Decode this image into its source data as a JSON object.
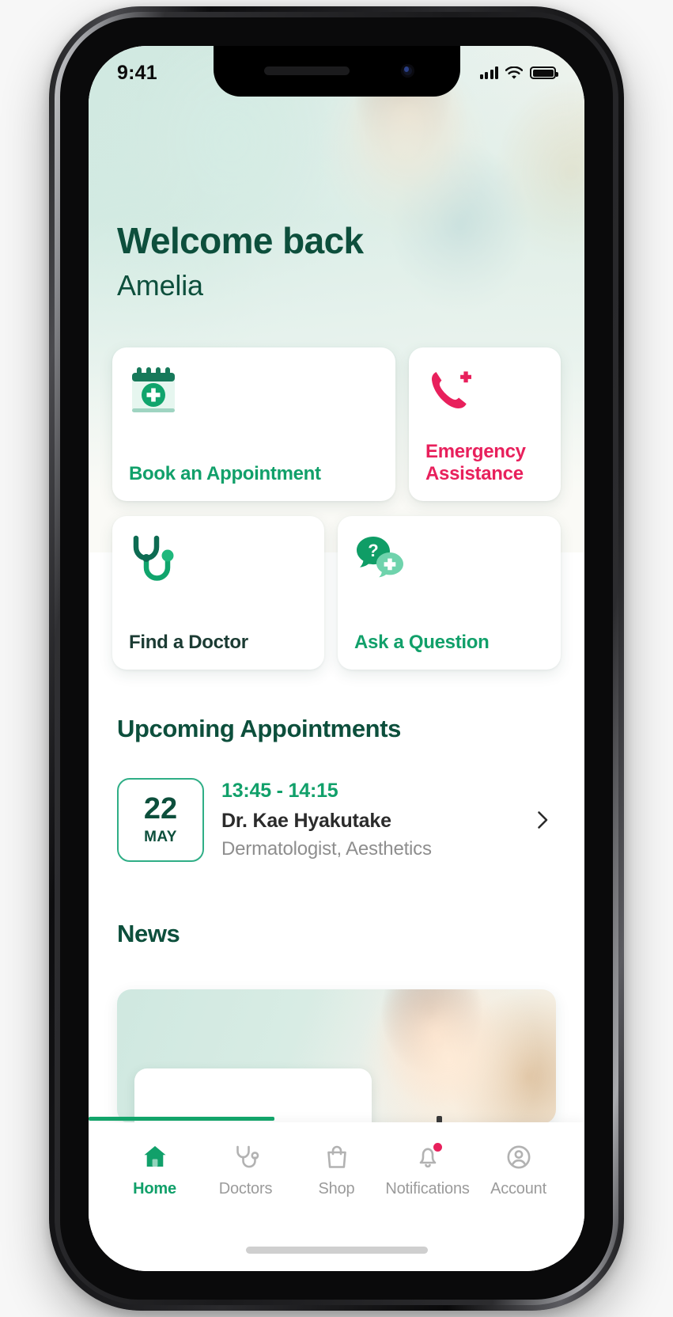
{
  "status_bar": {
    "time": "9:41",
    "signal_icon": "cellular-signal-icon",
    "wifi_icon": "wifi-icon",
    "battery_icon": "battery-full-icon"
  },
  "header": {
    "greeting": "Welcome back",
    "user_name": "Amelia"
  },
  "quick_actions": [
    {
      "id": "book-appointment",
      "label": "Book an Appointment",
      "icon": "calendar-plus-icon",
      "color": "#11a06a"
    },
    {
      "id": "emergency-assistance",
      "label": "Emergency Assistance",
      "icon": "phone-plus-icon",
      "color": "#e8205c"
    },
    {
      "id": "find-doctor",
      "label": "Find a Doctor",
      "icon": "stethoscope-icon",
      "color": "#1b3b33"
    },
    {
      "id": "ask-question",
      "label": "Ask a Question",
      "icon": "chat-question-icon",
      "color": "#11a06a"
    }
  ],
  "appointments": {
    "section_title": "Upcoming Appointments",
    "items": [
      {
        "day": "22",
        "month": "MAY",
        "time": "13:45 - 14:15",
        "doctor": "Dr. Kae Hyakutake",
        "specialty": "Dermatologist, Aesthetics",
        "chevron_icon": "chevron-right-icon"
      }
    ]
  },
  "news": {
    "section_title": "News"
  },
  "tab_bar": {
    "items": [
      {
        "id": "home",
        "label": "Home",
        "icon": "home-icon",
        "active": true,
        "badge": false
      },
      {
        "id": "doctors",
        "label": "Doctors",
        "icon": "stethoscope-icon",
        "active": false,
        "badge": false
      },
      {
        "id": "shop",
        "label": "Shop",
        "icon": "shopping-bag-icon",
        "active": false,
        "badge": false
      },
      {
        "id": "notifications",
        "label": "Notifications",
        "icon": "bell-icon",
        "active": false,
        "badge": true
      },
      {
        "id": "account",
        "label": "Account",
        "icon": "user-circle-icon",
        "active": false,
        "badge": false
      }
    ]
  },
  "theme": {
    "primary_green": "#11a06a",
    "dark_green": "#0d4f3c",
    "accent_pink": "#e8205c",
    "mint_bg": "#cfe8e0",
    "muted_text": "#8e8e8e"
  }
}
